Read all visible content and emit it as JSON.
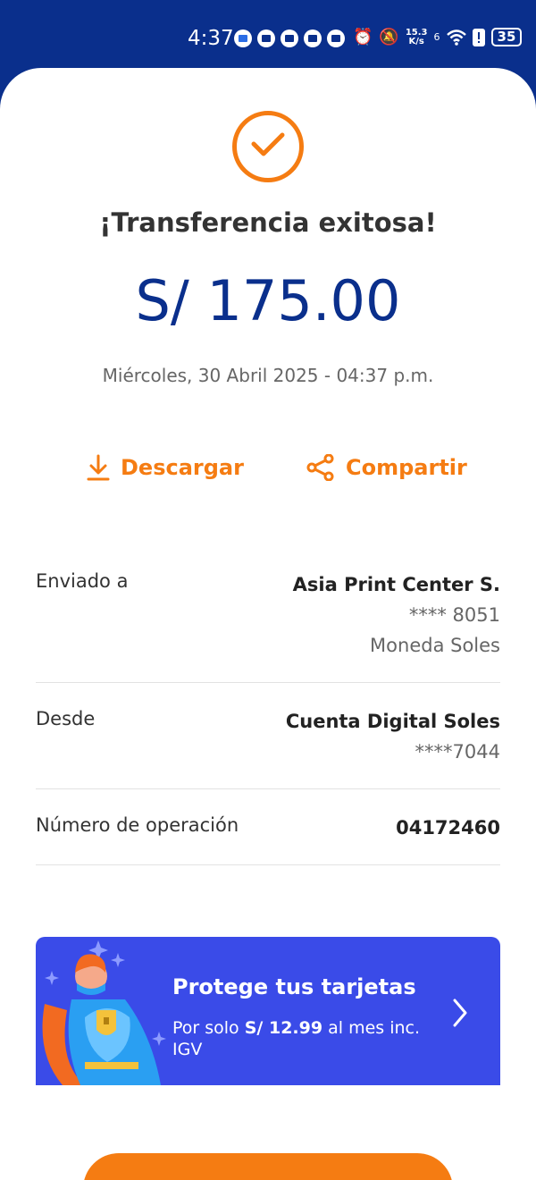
{
  "status_bar": {
    "time": "4:37",
    "speed_top": "15.3",
    "speed_bottom": "K/s",
    "signal": "6",
    "battery": "35"
  },
  "receipt": {
    "title": "¡Transferencia exitosa!",
    "amount": "S/ 175.00",
    "datetime": "Miércoles, 30 Abril 2025 - 04:37 p.m."
  },
  "actions": {
    "download_label": "Descargar",
    "share_label": "Compartir"
  },
  "details": {
    "sent_to": {
      "label": "Enviado a",
      "name": "Asia Print Center S.",
      "account": "**** 8051",
      "currency": "Moneda Soles"
    },
    "from": {
      "label": "Desde",
      "account_name": "Cuenta Digital Soles",
      "account_number": "****7044"
    },
    "operation": {
      "label": "Número de operación",
      "number": "04172460"
    }
  },
  "promo": {
    "title": "Protege tus tarjetas",
    "sub_prefix": "Por solo ",
    "sub_price": "S/ 12.99",
    "sub_suffix": " al mes inc. IGV"
  },
  "colors": {
    "brand_blue": "#0a2f8c",
    "accent_orange": "#f57c12",
    "promo_blue": "#3a4be8"
  }
}
